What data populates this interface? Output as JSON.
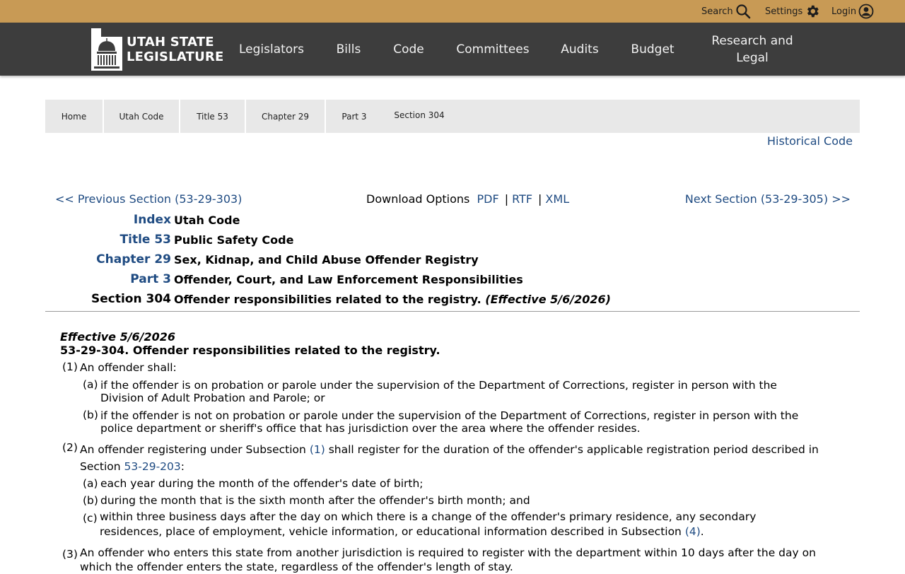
{
  "utility": {
    "search_label": "Search",
    "settings_label": "Settings",
    "login_label": "Login"
  },
  "logo": {
    "line1": "UTAH STATE",
    "line2": "LEGISLATURE"
  },
  "nav": {
    "items": [
      "Legislators",
      "Bills",
      "Code",
      "Committees",
      "Audits",
      "Budget",
      "Research and Legal"
    ]
  },
  "breadcrumb": [
    "Home",
    "Utah Code",
    "Title 53",
    "Chapter 29",
    "Part 3",
    "Section 304"
  ],
  "historical_link": "Historical Code",
  "section_nav": {
    "prev": "<< Previous Section (53-29-303)",
    "next": "Next Section (53-29-305) >>",
    "download_label": "Download Options",
    "pdf": "PDF",
    "rtf": "RTF",
    "xml": "XML",
    "separator": "|"
  },
  "heading": {
    "index_label": "Index",
    "index_value": "Utah Code",
    "title_label": "Title 53",
    "title_value": "Public Safety Code",
    "chapter_label": "Chapter 29",
    "chapter_value": "Sex, Kidnap, and Child Abuse Offender Registry",
    "part_label": "Part 3",
    "part_value": "Offender, Court, and Law Enforcement Responsibilities",
    "section_label": "Section 304",
    "section_value": "Offender responsibilities related to the registry.",
    "section_effective": "(Effective 5/6/2026)"
  },
  "body": {
    "effective": "Effective 5/6/2026",
    "title": "53-29-304.  Offender responsibilities related to the registry.",
    "p1_num": "(1)",
    "p1_text": "An offender shall:",
    "p1a_num": "(a)",
    "p1a_line1": "if the offender is on probation or parole under the supervision of the Department of Corrections, register in person with the",
    "p1a_line2": "Division of Adult Probation and Parole; or",
    "p1b_num": "(b)",
    "p1b_line1": "if the offender is not on probation or parole under the supervision of the Department of Corrections, register in person with the",
    "p1b_line2": "police department or sheriff's office that has jurisdiction over the area where the offender resides.",
    "p2_num": "(2)",
    "p2_text1": "An offender registering under Subsection",
    "p2_link1": "(1)",
    "p2_text2": "shall register for the duration of the offender's applicable registration period described in",
    "p2_text3": "Section",
    "p2_link2": "53-29-203",
    "p2_text4": ":",
    "p2a_num": "(a)",
    "p2a_text": "each year during the month of the offender's date of birth;",
    "p2b_num": "(b)",
    "p2b_text": "during the month that is the sixth month after the offender's birth month; and",
    "p2c_num": "(c)",
    "p2c_line1": "within three business days after the day on which there is a change of the offender's primary residence, any secondary",
    "p2c_line2": "residences, place of employment, vehicle information, or educational information described in Subsection",
    "p2c_link": "(4)",
    "p2c_end": ".",
    "p3_num": "(3)",
    "p3_line1": "An offender who enters this state from another jurisdiction is required to register with the department within 10 days after the day on",
    "p3_line2": "which the offender enters the state, regardless of the offender's length of stay."
  },
  "colors": {
    "utility_bar": "#c89a55",
    "nav_bar": "#3d3d3d",
    "link": "#1f4b82",
    "breadcrumb_bg": "#e8e8e8"
  }
}
